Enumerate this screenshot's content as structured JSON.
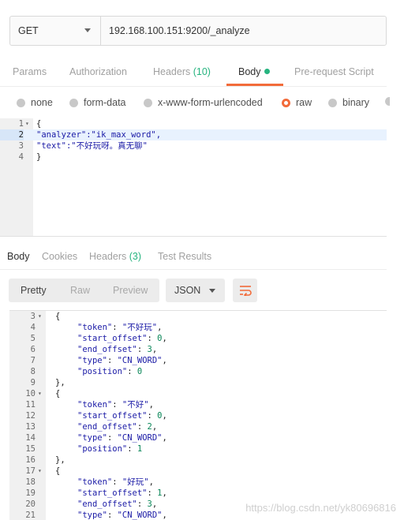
{
  "request": {
    "method": "GET",
    "url": "192.168.100.151:9200/_analyze"
  },
  "request_tabs": [
    {
      "label": "Params"
    },
    {
      "label": "Authorization"
    },
    {
      "label": "Headers",
      "count": "(10)"
    },
    {
      "label": "Body"
    },
    {
      "label": "Pre-request Script"
    }
  ],
  "body_types": [
    {
      "label": "none"
    },
    {
      "label": "form-data"
    },
    {
      "label": "x-www-form-urlencoded"
    },
    {
      "label": "raw",
      "selected": true
    },
    {
      "label": "binary"
    }
  ],
  "request_body": [
    {
      "n": "1",
      "k": "",
      "v": "{",
      "fold": true
    },
    {
      "n": "2",
      "k": "\"analyzer\"",
      "v": ":\"ik_max_word\",",
      "hl": true
    },
    {
      "n": "3",
      "k": "\"text\"",
      "v": ":\"不好玩呀。真无聊\""
    },
    {
      "n": "4",
      "k": "",
      "v": "}"
    }
  ],
  "response_tabs": [
    {
      "label": "Body"
    },
    {
      "label": "Cookies"
    },
    {
      "label": "Headers",
      "count": "(3)"
    },
    {
      "label": "Test Results"
    }
  ],
  "response_toolbar": {
    "pretty": "Pretty",
    "raw": "Raw",
    "preview": "Preview",
    "format": "JSON"
  },
  "response_body": [
    {
      "n": "3",
      "fold": true,
      "text": "{"
    },
    {
      "n": "4",
      "key": "\"token\"",
      "val": "\"不好玩\"",
      "type": "s",
      "tail": ","
    },
    {
      "n": "5",
      "key": "\"start_offset\"",
      "val": "0",
      "type": "n",
      "tail": ","
    },
    {
      "n": "6",
      "key": "\"end_offset\"",
      "val": "3",
      "type": "n",
      "tail": ","
    },
    {
      "n": "7",
      "key": "\"type\"",
      "val": "\"CN_WORD\"",
      "type": "s",
      "tail": ","
    },
    {
      "n": "8",
      "key": "\"position\"",
      "val": "0",
      "type": "n",
      "tail": ""
    },
    {
      "n": "9",
      "text": "},"
    },
    {
      "n": "10",
      "fold": true,
      "text": "{"
    },
    {
      "n": "11",
      "key": "\"token\"",
      "val": "\"不好\"",
      "type": "s",
      "tail": ","
    },
    {
      "n": "12",
      "key": "\"start_offset\"",
      "val": "0",
      "type": "n",
      "tail": ","
    },
    {
      "n": "13",
      "key": "\"end_offset\"",
      "val": "2",
      "type": "n",
      "tail": ","
    },
    {
      "n": "14",
      "key": "\"type\"",
      "val": "\"CN_WORD\"",
      "type": "s",
      "tail": ","
    },
    {
      "n": "15",
      "key": "\"position\"",
      "val": "1",
      "type": "n",
      "tail": ""
    },
    {
      "n": "16",
      "text": "},"
    },
    {
      "n": "17",
      "fold": true,
      "text": "{"
    },
    {
      "n": "18",
      "key": "\"token\"",
      "val": "\"好玩\"",
      "type": "s",
      "tail": ","
    },
    {
      "n": "19",
      "key": "\"start_offset\"",
      "val": "1",
      "type": "n",
      "tail": ","
    },
    {
      "n": "20",
      "key": "\"end_offset\"",
      "val": "3",
      "type": "n",
      "tail": ","
    },
    {
      "n": "21",
      "key": "\"type\"",
      "val": "\"CN_WORD\"",
      "type": "s",
      "tail": ","
    }
  ],
  "watermark": "https://blog.csdn.net/yk80696816",
  "colors": {
    "accent": "#f26b3a",
    "green": "#26b47f"
  }
}
